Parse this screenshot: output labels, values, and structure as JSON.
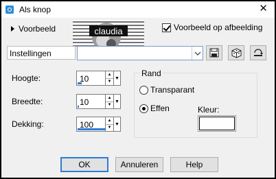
{
  "window": {
    "title": "Als knop"
  },
  "preview": {
    "toggle_label": "Voorbeeld",
    "thumbnail_text": "claudia",
    "on_image_label": "Voorbeeld op afbeelding",
    "on_image_checked": true
  },
  "settings": {
    "label": "Instellingen",
    "preset_value": ""
  },
  "fields": {
    "height": {
      "label": "Hoogte:",
      "value": "10"
    },
    "width": {
      "label": "Breedte:",
      "value": "10"
    },
    "opacity": {
      "label": "Dekking:",
      "value": "100"
    }
  },
  "edge": {
    "title": "Rand",
    "transparent_label": "Transparant",
    "solid_label": "Effen",
    "selected": "solid",
    "color_label": "Kleur:",
    "color": "#ffffff"
  },
  "buttons": {
    "ok": "OK",
    "cancel": "Annuleren",
    "help": "Help"
  }
}
